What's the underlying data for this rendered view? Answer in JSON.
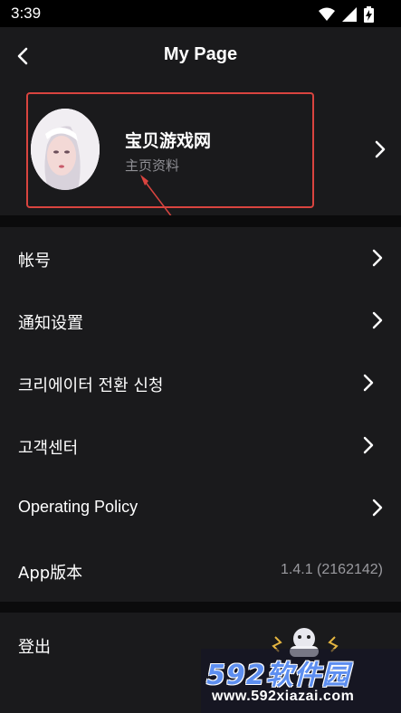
{
  "status_bar": {
    "time": "3:39",
    "icons": [
      "wifi-icon",
      "signal-icon",
      "battery-charging-icon"
    ]
  },
  "header": {
    "title": "My Page",
    "back_icon": "chevron-left-icon"
  },
  "profile": {
    "name": "宝贝游戏网",
    "subtitle": "主页资料",
    "chevron_icon": "chevron-right-icon"
  },
  "menu": {
    "items": [
      {
        "label": "帐号",
        "chevron": true
      },
      {
        "label": "通知设置",
        "chevron": true
      },
      {
        "label": "크리에이터 전환 신청",
        "chevron": true
      },
      {
        "label": "고객센터",
        "chevron": true
      },
      {
        "label": "Operating Policy",
        "chevron": true
      },
      {
        "label": "App版本",
        "value": "1.4.1 (2162142)"
      }
    ]
  },
  "logout": {
    "label": "登出"
  },
  "watermark": {
    "brand": "592软件园",
    "url": "www.592xiazai.com"
  },
  "colors": {
    "background": "#1a1a1c",
    "separator": "#0b0b0c",
    "annotation": "#d9443f",
    "secondary_text": "#8f8f94",
    "watermark_blue": "#5d8ef0"
  }
}
